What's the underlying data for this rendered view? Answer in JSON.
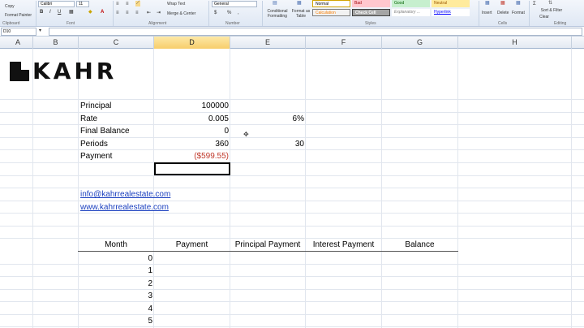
{
  "ribbon": {
    "clipboard": {
      "copy": "Copy",
      "format_painter": "Format Painter",
      "group": "Clipboard"
    },
    "font": {
      "name": "Calibri",
      "size": "11",
      "group": "Font",
      "bold": "B",
      "italic": "I",
      "underline": "U"
    },
    "alignment": {
      "wrap_text": "Wrap Text",
      "merge_center": "Merge & Center",
      "group": "Alignment"
    },
    "number": {
      "format": "General",
      "currency": "$",
      "percent": "%",
      "comma": ",",
      "group": "Number"
    },
    "styles": {
      "conditional": "Conditional Formatting",
      "format_as_table": "Format as Table",
      "normal": "Normal",
      "bad": "Bad",
      "good": "Good",
      "neutral": "Neutral",
      "calculation": "Calculation",
      "check_cell": "Check Cell",
      "explanatory": "Explanatory ...",
      "hyperlink": "Hyperlink",
      "group": "Styles"
    },
    "cells": {
      "insert": "Insert",
      "delete": "Delete",
      "format": "Format",
      "group": "Cells"
    },
    "editing": {
      "sort_filter": "Sort & Filter",
      "clear": "Clear",
      "group": "Editing"
    },
    "colors": {
      "bad": "#ffc7ce",
      "good": "#c6efce",
      "neutral": "#ffeb9c",
      "calculation": "#f2f2f2",
      "check_cell": "#a5a5a5"
    }
  },
  "formula_bar": {
    "name_box": "D10",
    "formula": ""
  },
  "columns": [
    "A",
    "B",
    "C",
    "D",
    "E",
    "F",
    "G",
    "H"
  ],
  "selected_column": "D",
  "logo": {
    "text": "KAHR"
  },
  "inputs": [
    {
      "label": "Principal",
      "value": "100000",
      "extra": ""
    },
    {
      "label": "Rate",
      "value": "0.005",
      "extra": "6%"
    },
    {
      "label": "Final Balance",
      "value": "0",
      "extra": ""
    },
    {
      "label": "Periods",
      "value": "360",
      "extra": "30"
    },
    {
      "label": "Payment",
      "value": "($599.55)",
      "extra": ""
    }
  ],
  "links": {
    "email": "info@kahrrealestate.com",
    "website": "www.kahrrealestate.com"
  },
  "table": {
    "headers": [
      "Month",
      "Payment",
      "Principal Payment",
      "Interest Payment",
      "Balance"
    ],
    "months": [
      "0",
      "1",
      "2",
      "3",
      "4",
      "5"
    ]
  }
}
